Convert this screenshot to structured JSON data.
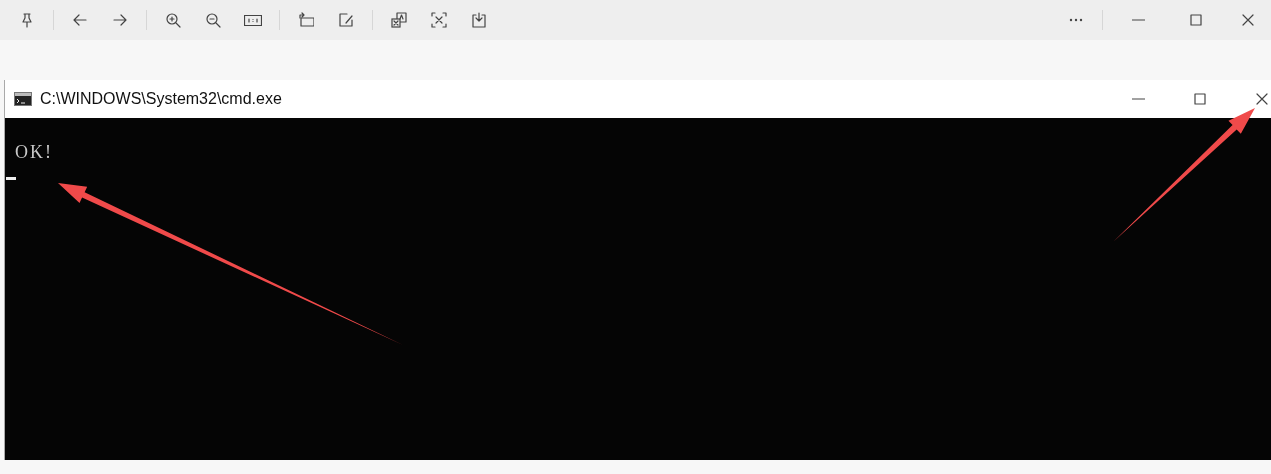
{
  "cmd_window": {
    "title": "C:\\WINDOWS\\System32\\cmd.exe"
  },
  "console": {
    "lines": [
      "OK!"
    ],
    "cursor": true
  }
}
